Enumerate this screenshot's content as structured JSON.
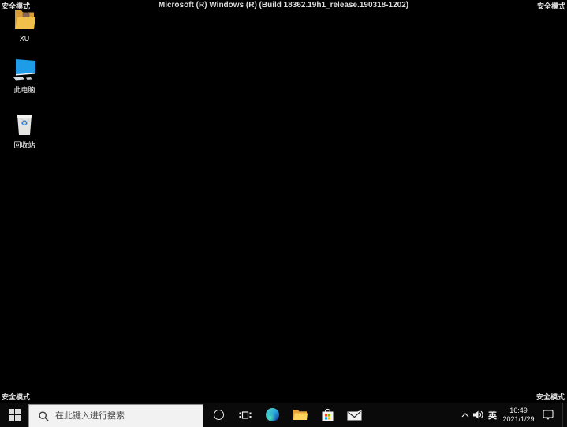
{
  "system": {
    "safe_mode_label": "安全模式",
    "build_banner": "Microsoft (R) Windows (R) (Build 18362.19h1_release.190318-1202)"
  },
  "desktop": {
    "icons": [
      {
        "label": "XU",
        "icon": "user-folder-icon"
      },
      {
        "label": "此电脑",
        "icon": "this-pc-icon"
      },
      {
        "label": "回收站",
        "icon": "recycle-bin-icon"
      }
    ]
  },
  "taskbar": {
    "search": {
      "placeholder": "在此键入进行搜索",
      "icon": "search-icon"
    },
    "button_icons": [
      "start-icon",
      "cortana-icon",
      "task-view-icon",
      "edge-icon",
      "file-explorer-icon",
      "store-icon",
      "mail-icon"
    ],
    "tray": {
      "icons": [
        "chevron-up-icon",
        "speaker-icon",
        "action-center-icon"
      ],
      "input_method": "英",
      "time": "16:49",
      "date": "2021/1/29"
    }
  },
  "colors": {
    "desktop_bg": "#000000",
    "taskbar_bg": "#0a0a0a",
    "search_box_bg": "#f2f2f2",
    "search_text": "#3d3d3d",
    "corner_text": "#e2e2e2",
    "folder_yellow": "#ffd45e",
    "monitor_blue": "#1e9ce8",
    "recycle_blue": "#2f7fd6",
    "edge_gradient": [
      "#5ae0c0",
      "#2aa7dd",
      "#1a5ab8"
    ],
    "store_squares": [
      "#f25022",
      "#7fba00",
      "#00a4ef",
      "#ffb900"
    ]
  }
}
